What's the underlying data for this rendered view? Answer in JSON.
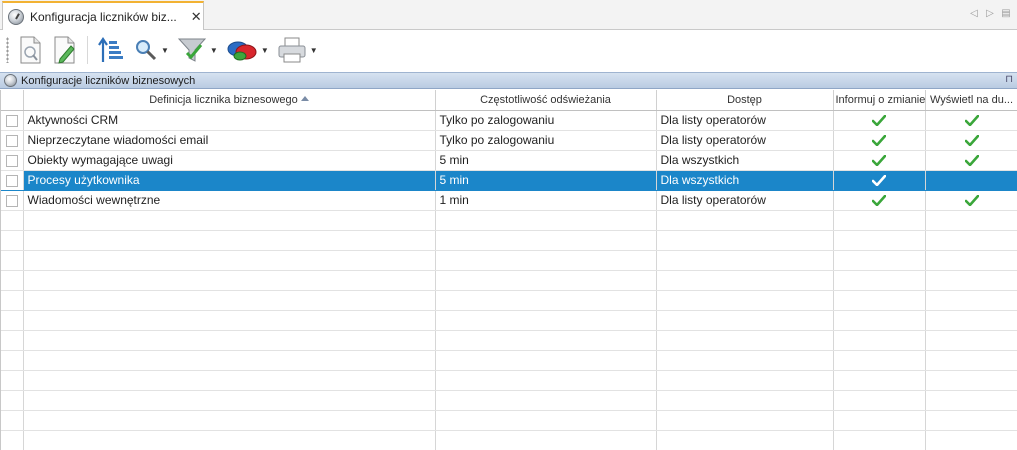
{
  "tab": {
    "title": "Konfiguracja liczników biz...",
    "close": "✕"
  },
  "tab_nav": {
    "prev": "◁",
    "next": "▷",
    "menu": "▤"
  },
  "toolbar": {
    "icons": [
      "new-document-icon",
      "edit-document-icon",
      "sort-list-icon",
      "search-icon",
      "filter-icon",
      "group-icon",
      "print-icon"
    ],
    "dropdown_glyph": "▼"
  },
  "panel": {
    "title": "Konfiguracje liczników biznesowych",
    "pin": "⊓"
  },
  "grid": {
    "columns": [
      "",
      "Definicja licznika biznesowego",
      "Częstotliwość odświeżania",
      "Dostęp",
      "Informuj o zmianie",
      "Wyświetl na du..."
    ],
    "rows": [
      {
        "name": "Aktywności CRM",
        "frequency": "Tylko po zalogowaniu",
        "access": "Dla listy operatorów",
        "inform": true,
        "display": true,
        "selected": false
      },
      {
        "name": "Nieprzeczytane wiadomości email",
        "frequency": "Tylko po zalogowaniu",
        "access": "Dla listy operatorów",
        "inform": true,
        "display": true,
        "selected": false
      },
      {
        "name": "Obiekty wymagające uwagi",
        "frequency": "5 min",
        "access": "Dla wszystkich",
        "inform": true,
        "display": true,
        "selected": false
      },
      {
        "name": "Procesy użytkownika",
        "frequency": "5 min",
        "access": "Dla wszystkich",
        "inform": true,
        "display": false,
        "selected": true
      },
      {
        "name": "Wiadomości wewnętrzne",
        "frequency": "1 min",
        "access": "Dla listy operatorów",
        "inform": true,
        "display": true,
        "selected": false
      }
    ]
  },
  "colors": {
    "tab_accent": "#f2b233",
    "selection": "#1b86c9",
    "check_green": "#3aa63a"
  }
}
